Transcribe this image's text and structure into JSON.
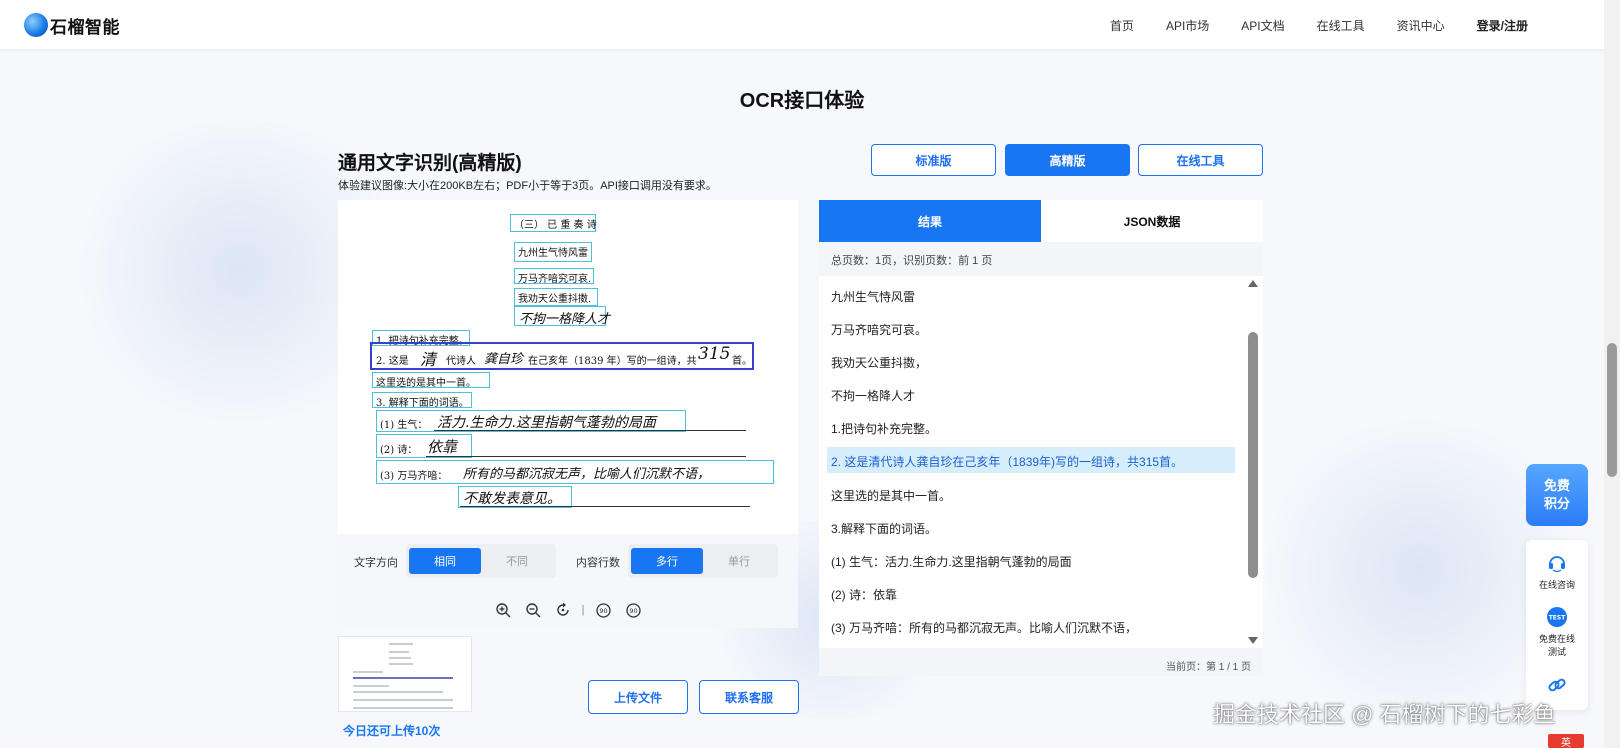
{
  "header": {
    "logo_text": "石榴智能",
    "nav": [
      "首页",
      "API市场",
      "API文档",
      "在线工具",
      "资讯中心"
    ],
    "login": "登录/注册"
  },
  "page_title": "OCR接口体验",
  "section": {
    "title": "通用文字识别(高精版)",
    "hint": "体验建议图像:大小在200KB左右；PDF小于等于3页。API接口调用没有要求。"
  },
  "version_buttons": {
    "standard": "标准版",
    "high": "高精版",
    "online_tool": "在线工具"
  },
  "document": {
    "heading": "（三） 已 重 奏 诗",
    "lines": [
      "九州生气恃风雷",
      "万马齐喑究可哀.",
      "我劝天公重抖擞.",
      "不拘一格降人才",
      "1. 把诗句补充完整。",
      "2. 这是",
      "清",
      "代诗人",
      "龚自珍",
      "在己亥年（1839 年）写的一组诗，共",
      "315",
      "首。",
      "这里选的是其中一首。",
      "3. 解释下面的词语。",
      "(1) 生气：",
      "活力.生命力.这里指朝气蓬勃的局面",
      "(2) 诗：",
      "依靠",
      "(3) 万马齐喑：",
      "所有的马都沉寂无声，比喻人们沉默不语，",
      "不敢发表意见。"
    ]
  },
  "controls": {
    "direction_label": "文字方向",
    "direction_options": [
      "相同",
      "不同"
    ],
    "direction_active": 0,
    "rows_label": "内容行数",
    "rows_options": [
      "多行",
      "单行"
    ],
    "rows_active": 0
  },
  "zoom_icons": [
    "zoom-in-icon",
    "zoom-out-icon",
    "rotate-icon",
    "rotate-left-90-icon",
    "rotate-right-90-icon"
  ],
  "zoom_icon_labels": [
    "90",
    "90"
  ],
  "thumbnail_note": "今日还可上传10次",
  "actions": {
    "upload": "上传文件",
    "contact": "联系客服"
  },
  "result": {
    "tabs": [
      "结果",
      "JSON数据"
    ],
    "active_tab": 0,
    "summary": "总页数：1页，识别页数：前 1 页",
    "lines": [
      "九州生气恃风雷",
      "万马齐喑究可哀。",
      "我劝天公重抖擞，",
      "不拘一格降人才",
      "1.把诗句补充完整。",
      "2. 这是清代诗人龚自珍在己亥年（1839年)写的一组诗，共315首。",
      "这里选的是其中一首。",
      "3.解释下面的词语。",
      "(1) 生气：活力.生命力.这里指朝气蓬勃的局面",
      "(2) 诗：依靠",
      "(3) 万马齐喑：所有的马都沉寂无声。比喻人们沉默不语，"
    ],
    "highlighted_index": 5,
    "pager": "当前页：第 1 / 1 页"
  },
  "float": {
    "credit": "免费\n积分",
    "consult": "在线咨询",
    "test_badge": "TEST",
    "test": "免费在线\n测试"
  },
  "watermark": "掘金技术社区 @ 石榴树下的七彩鱼",
  "corner_badge": "英",
  "colors": {
    "primary": "#1976f2",
    "highlight_bg": "#d6eefc",
    "box_cyan": "#4cc1dc",
    "box_selected": "#3840c8"
  }
}
